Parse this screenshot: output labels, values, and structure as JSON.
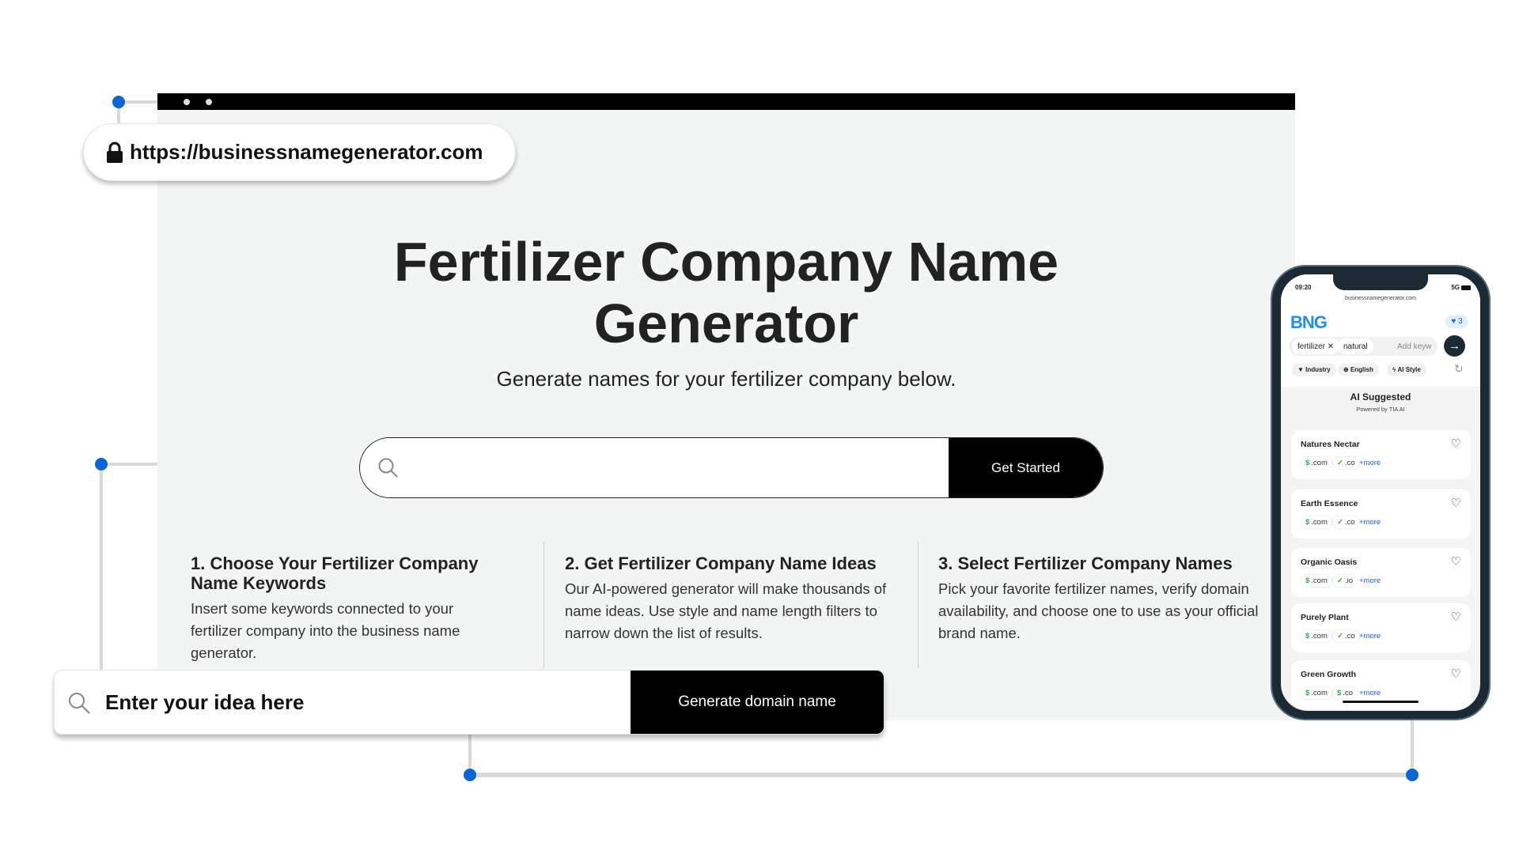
{
  "browser": {
    "url": "https://businessnamegenerator.com",
    "icon": "lock-icon"
  },
  "hero": {
    "title": "Fertilizer Company Name Generator",
    "subtitle": "Generate names for your fertilizer company below.",
    "search_placeholder": "",
    "cta": "Get Started"
  },
  "steps": [
    {
      "title": "1. Choose Your Fertilizer Company Name Keywords",
      "body": "Insert some keywords connected to your fertilizer company into the business name generator."
    },
    {
      "title": "2. Get Fertilizer Company Name Ideas",
      "body": "Our AI-powered generator will make thousands of name ideas. Use style and name length filters to narrow down the list of results."
    },
    {
      "title": "3. Select Fertilizer Company Names",
      "body": "Pick your favorite fertilizer names, verify domain availability, and choose one to use as your official brand name."
    }
  ],
  "domain_search": {
    "placeholder": "Enter your idea here",
    "button": "Generate domain name"
  },
  "accent": "#0a66d6",
  "phone": {
    "time": "09:20",
    "network": "5G",
    "url": "businessnamegenerator.com",
    "logo": "BNG",
    "favorites": "3",
    "keywords": [
      "fertilizer",
      "natural"
    ],
    "keyword_placeholder": "Add keyw",
    "filters": [
      "Industry",
      "English",
      "AI Style"
    ],
    "section_title": "AI Suggested",
    "powered": "Powered by TIA AI",
    "names": [
      {
        "name": "Natures Nectar",
        "tlds": [
          {
            "mark": "$",
            "tld": ".com"
          },
          {
            "mark": "✓",
            "tld": ".co"
          }
        ],
        "more": "+more"
      },
      {
        "name": "Earth Essence",
        "tlds": [
          {
            "mark": "$",
            "tld": ".com"
          },
          {
            "mark": "✓",
            "tld": ".co"
          }
        ],
        "more": "+more"
      },
      {
        "name": "Organic Oasis",
        "tlds": [
          {
            "mark": "$",
            "tld": ".com"
          },
          {
            "mark": "✓",
            "tld": ".io"
          }
        ],
        "more": "+more"
      },
      {
        "name": "Purely Plant",
        "tlds": [
          {
            "mark": "$",
            "tld": ".com"
          },
          {
            "mark": "✓",
            "tld": ".co"
          }
        ],
        "more": "+more"
      },
      {
        "name": "Green Growth",
        "tlds": [
          {
            "mark": "$",
            "tld": ".com"
          },
          {
            "mark": "$",
            "tld": ".co"
          }
        ],
        "more": "+more"
      }
    ]
  }
}
